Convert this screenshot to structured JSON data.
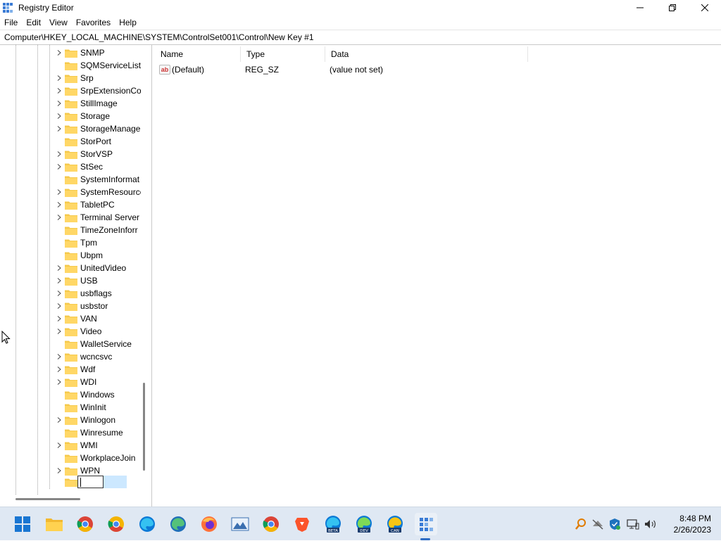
{
  "window": {
    "title": "Registry Editor"
  },
  "menu": [
    "File",
    "Edit",
    "View",
    "Favorites",
    "Help"
  ],
  "address": "Computer\\HKEY_LOCAL_MACHINE\\SYSTEM\\ControlSet001\\Control\\New Key #1",
  "tree": [
    {
      "label": "SNMP",
      "expander": true
    },
    {
      "label": "SQMServiceList",
      "expander": false
    },
    {
      "label": "Srp",
      "expander": true
    },
    {
      "label": "SrpExtensionCo",
      "expander": true
    },
    {
      "label": "StillImage",
      "expander": true
    },
    {
      "label": "Storage",
      "expander": true
    },
    {
      "label": "StorageManage",
      "expander": true
    },
    {
      "label": "StorPort",
      "expander": false
    },
    {
      "label": "StorVSP",
      "expander": true
    },
    {
      "label": "StSec",
      "expander": true
    },
    {
      "label": "SystemInformat",
      "expander": false
    },
    {
      "label": "SystemResource",
      "expander": true
    },
    {
      "label": "TabletPC",
      "expander": true
    },
    {
      "label": "Terminal Server",
      "expander": true
    },
    {
      "label": "TimeZoneInforr",
      "expander": false
    },
    {
      "label": "Tpm",
      "expander": false
    },
    {
      "label": "Ubpm",
      "expander": false
    },
    {
      "label": "UnitedVideo",
      "expander": true
    },
    {
      "label": "USB",
      "expander": true
    },
    {
      "label": "usbflags",
      "expander": true
    },
    {
      "label": "usbstor",
      "expander": true
    },
    {
      "label": "VAN",
      "expander": true
    },
    {
      "label": "Video",
      "expander": true
    },
    {
      "label": "WalletService",
      "expander": false
    },
    {
      "label": "wcncsvc",
      "expander": true
    },
    {
      "label": "Wdf",
      "expander": true
    },
    {
      "label": "WDI",
      "expander": true
    },
    {
      "label": "Windows",
      "expander": false
    },
    {
      "label": "WinInit",
      "expander": false
    },
    {
      "label": "Winlogon",
      "expander": true
    },
    {
      "label": "Winresume",
      "expander": false
    },
    {
      "label": "WMI",
      "expander": true
    },
    {
      "label": "WorkplaceJoin",
      "expander": false
    },
    {
      "label": "WPN",
      "expander": true
    }
  ],
  "rename": {
    "value": ""
  },
  "list": {
    "columns": [
      "Name",
      "Type",
      "Data"
    ],
    "rows": [
      {
        "name": "(Default)",
        "type": "REG_SZ",
        "data": "(value not set)"
      }
    ]
  },
  "taskbar": {
    "apps": [
      "start-icon",
      "file-explorer-icon",
      "chrome-icon",
      "chrome-canary-icon",
      "edge-icon",
      "edge-preview-icon",
      "firefox-icon",
      "photos-icon",
      "chrome-icon",
      "brave-icon",
      "edge-beta-icon",
      "edge-dev-icon",
      "edge-canary-icon",
      "registry-editor-icon"
    ],
    "beta_label": "BETA",
    "dev_label": "DEV",
    "can_label": "CAN"
  },
  "clock": {
    "time": "8:48 PM",
    "date": "2/26/2023"
  },
  "colors": {
    "accent": "#2d6bc4",
    "folder": "#f5c94b",
    "selection": "#cce8ff"
  }
}
